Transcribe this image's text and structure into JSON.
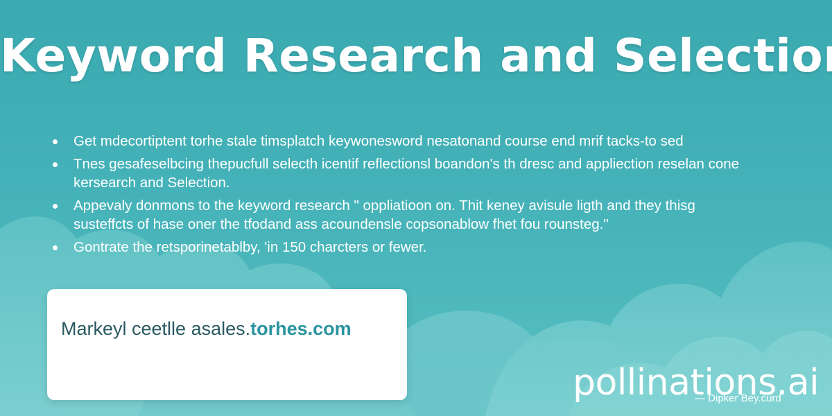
{
  "page": {
    "title": "Keyword Research and Selection"
  },
  "bullets": [
    "Get mdecortiptent torhe stale timsplatch keywonesword nesatonand course end mrif tacks-to sed",
    "Tnes gesafeselbcing thepucfull selecth icentif reflectionsl boandon's th dresc and appliection reselan cone kersearch and Selection.",
    "Appevaly donmons to the keyword research \" oppliatioon on. Thit keney avisule ligth and they thisg susteffcts of hase oner the tfodand ass acoundensle copsonablow fhet fou rounsteg.\"",
    "Gontrate the retsporinetablby, 'in 150 charcters or fewer."
  ],
  "card": {
    "text": "Markeyl ceetlle asales.",
    "domain": "torhes.com"
  },
  "watermark": "pollinations.ai",
  "attribution": "— Dipker Bey.curd",
  "colors": {
    "background": "#44b2b8",
    "cloud": "#6cc8cb",
    "card": "#ffffff",
    "card_text": "#2b5a63",
    "card_domain": "#2a93a0"
  }
}
